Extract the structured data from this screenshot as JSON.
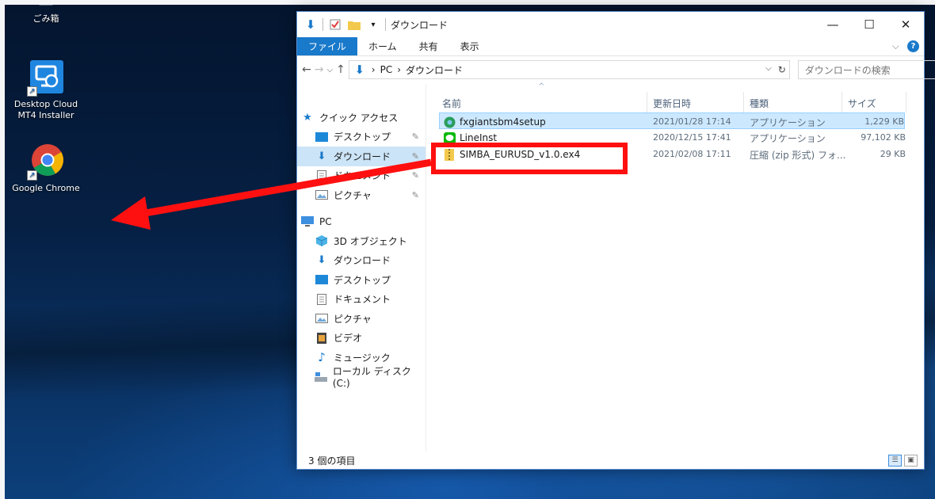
{
  "desktop": {
    "icons": [
      {
        "label": "ごみ箱",
        "icon": "recycle-bin-icon"
      },
      {
        "label": "Desktop Cloud MT4 Installer",
        "icon": "installer-icon"
      },
      {
        "label": "Google Chrome",
        "icon": "chrome-icon"
      }
    ]
  },
  "window": {
    "title": "ダウンロード",
    "controls": {
      "minimize": "—",
      "maximize": "☐",
      "close": "✕"
    },
    "ribbon_tabs": [
      "ファイル",
      "ホーム",
      "共有",
      "表示"
    ],
    "address": {
      "segments": [
        "PC",
        "ダウンロード"
      ],
      "separator": "›"
    },
    "search_placeholder": "ダウンロードの検索",
    "nav": {
      "quick_access": "クイック アクセス",
      "quick_items": [
        "デスクトップ",
        "ダウンロード",
        "ドキュメント",
        "ピクチャ"
      ],
      "pc": "PC",
      "pc_items": [
        "3D オブジェクト",
        "ダウンロード",
        "デスクトップ",
        "ドキュメント",
        "ピクチャ",
        "ビデオ",
        "ミュージック",
        "ローカル ディスク (C:)"
      ]
    },
    "columns": {
      "name": "名前",
      "date": "更新日時",
      "type": "種類",
      "size": "サイズ"
    },
    "files": [
      {
        "name": "fxgiantsbm4setup",
        "date": "2021/01/28 17:14",
        "type": "アプリケーション",
        "size": "1,229 KB"
      },
      {
        "name": "LineInst",
        "date": "2020/12/15 17:41",
        "type": "アプリケーション",
        "size": "97,102 KB"
      },
      {
        "name": "SIMBA_EURUSD_v1.0.ex4",
        "date": "2021/02/08 17:11",
        "type": "圧縮 (zip 形式) フォ...",
        "size": "29 KB"
      }
    ],
    "status": "3 個の項目"
  },
  "colors": {
    "accent": "#1979ca",
    "highlight": "#ff1010",
    "selection": "#cce8ff"
  }
}
